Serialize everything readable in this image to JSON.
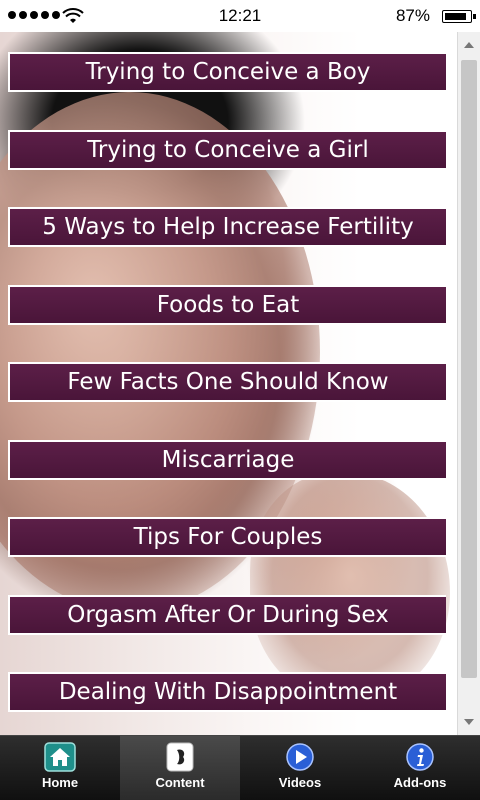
{
  "status_bar": {
    "time": "12:21",
    "battery": "87%",
    "battery_level": 0.87
  },
  "menu": {
    "items": [
      {
        "label": "Trying to Conceive a Boy"
      },
      {
        "label": "Trying to Conceive a Girl"
      },
      {
        "label": "5 Ways to Help Increase Fertility"
      },
      {
        "label": "Foods to Eat"
      },
      {
        "label": "Few Facts One Should Know"
      },
      {
        "label": "Miscarriage"
      },
      {
        "label": "Tips For Couples"
      },
      {
        "label": "Orgasm After Or During Sex"
      },
      {
        "label": "Dealing With Disappointment"
      }
    ]
  },
  "tab_bar": {
    "tabs": [
      {
        "label": "Home",
        "icon": "home-icon",
        "active": false
      },
      {
        "label": "Content",
        "icon": "content-icon",
        "active": true
      },
      {
        "label": "Videos",
        "icon": "play-icon",
        "active": false
      },
      {
        "label": "Add-ons",
        "icon": "info-icon",
        "active": false
      }
    ]
  },
  "colors": {
    "menu_item_bg": "#4f1a3e",
    "menu_item_border": "#ffffff",
    "tab_bar_bg": "#1a1a1a"
  }
}
